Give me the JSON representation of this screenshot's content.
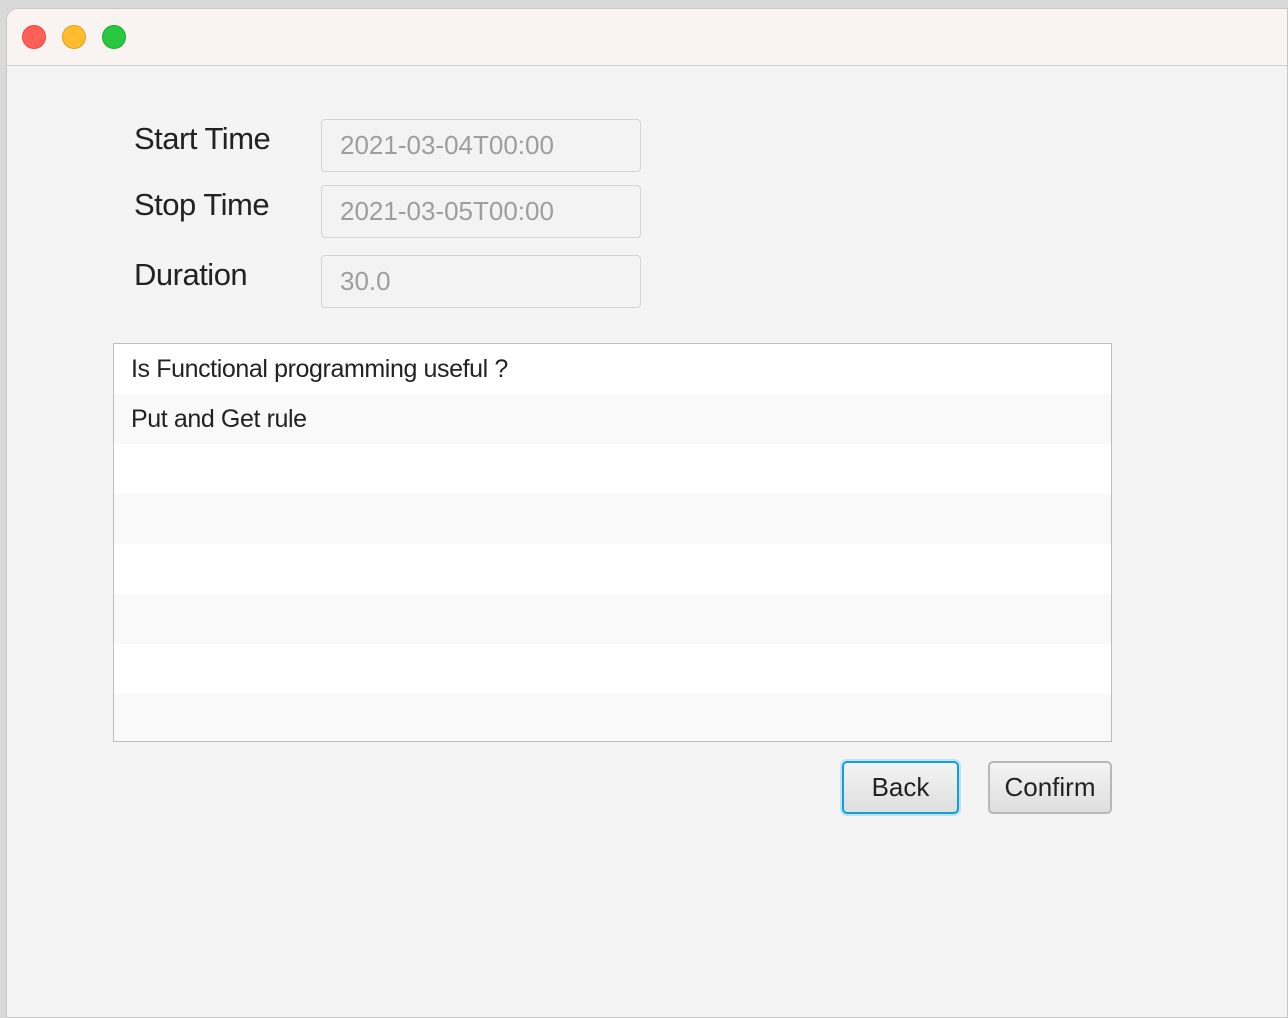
{
  "window": {
    "traffic_lights": [
      "close",
      "minimize",
      "zoom"
    ]
  },
  "form": {
    "start_label": "Start Time",
    "start_value": "2021-03-04T00:00",
    "stop_label": "Stop Time",
    "stop_value": "2021-03-05T00:00",
    "duration_label": "Duration",
    "duration_value": "30.0"
  },
  "list": {
    "items": [
      "Is Functional programming useful ?",
      "Put and Get rule"
    ]
  },
  "buttons": {
    "back": "Back",
    "confirm": "Confirm"
  }
}
